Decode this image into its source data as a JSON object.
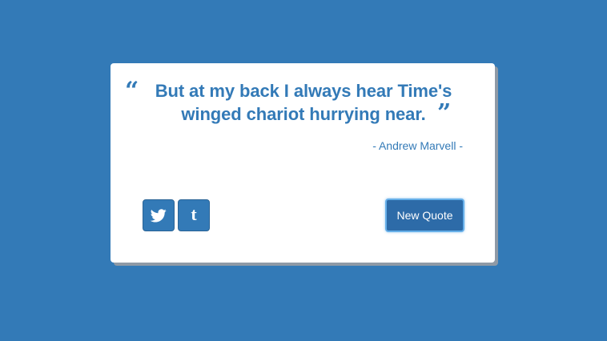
{
  "quote": {
    "open_mark": "“",
    "text": "But at my back I always hear Time's winged chariot hurrying near.",
    "close_mark": "”",
    "author": "- Andrew Marvell -"
  },
  "actions": {
    "twitter_icon": "twitter-icon",
    "tumblr_icon": "tumblr-icon",
    "tumblr_glyph": "t",
    "new_quote_label": "New Quote"
  },
  "colors": {
    "background": "#337ab7",
    "accent": "#337ab7",
    "card": "#ffffff"
  }
}
